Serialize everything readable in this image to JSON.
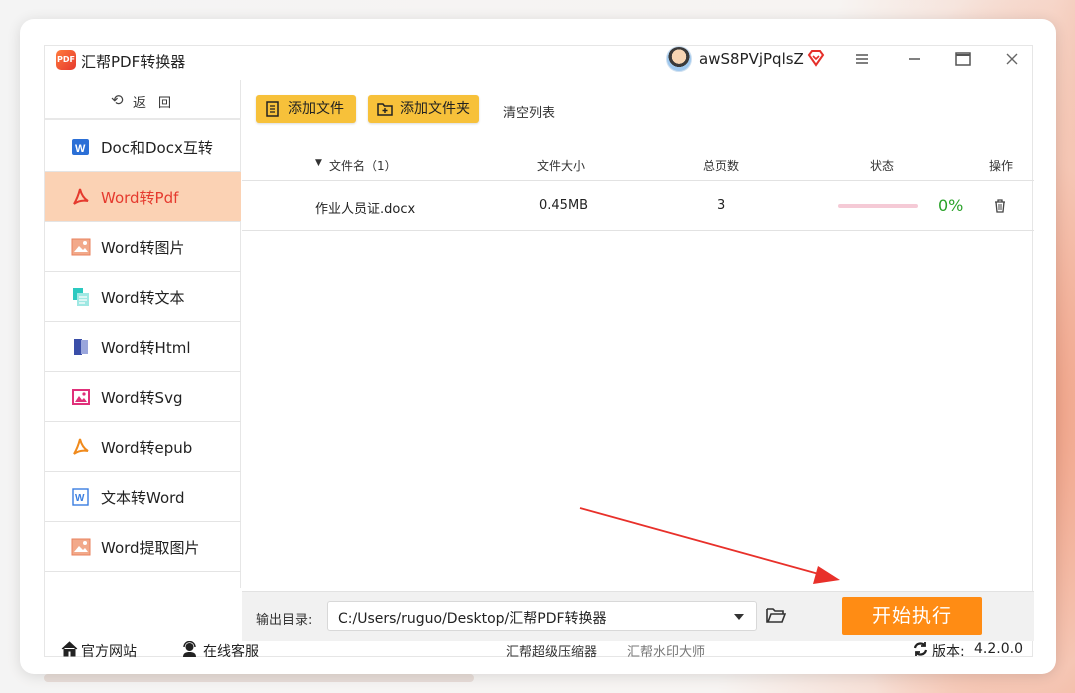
{
  "app": {
    "title": "汇帮PDF转换器",
    "logo_text": "PDF",
    "username": "awS8PVjPqlsZ"
  },
  "sidebar": {
    "back_label": "返回",
    "items": [
      {
        "label": "Doc和Docx互转",
        "icon": "word-icon",
        "color": "#2b6fd6"
      },
      {
        "label": "Word转Pdf",
        "icon": "pdf-icon",
        "color": "#e53a2e",
        "active": true
      },
      {
        "label": "Word转图片",
        "icon": "image-icon",
        "color": "#e8825e"
      },
      {
        "label": "Word转文本",
        "icon": "text-doc-icon",
        "color": "#2bc9c0"
      },
      {
        "label": "Word转Html",
        "icon": "book-icon",
        "color": "#3a4ea8"
      },
      {
        "label": "Word转Svg",
        "icon": "image-icon",
        "color": "#e0307a"
      },
      {
        "label": "Word转epub",
        "icon": "pdf-icon",
        "color": "#f08a1c"
      },
      {
        "label": "文本转Word",
        "icon": "word-icon",
        "color": "#3a7ee0"
      },
      {
        "label": "Word提取图片",
        "icon": "image-icon",
        "color": "#e8825e"
      }
    ]
  },
  "toolbar": {
    "add_file": "添加文件",
    "add_folder": "添加文件夹",
    "clear_list": "清空列表"
  },
  "table": {
    "headers": {
      "filename": "文件名（1）",
      "size": "文件大小",
      "pages": "总页数",
      "status": "状态",
      "action": "操作"
    },
    "rows": [
      {
        "filename": "作业人员证.docx",
        "size": "0.45MB",
        "pages": "3",
        "progress": 0,
        "progress_text": "0%"
      }
    ]
  },
  "output": {
    "label": "输出目录:",
    "path": "C:/Users/ruguo/Desktop/汇帮PDF转换器",
    "start": "开始执行"
  },
  "footer": {
    "website": "官方网站",
    "service": "在线客服",
    "compressor": "汇帮超级压缩器",
    "watermark": "汇帮水印大师",
    "version_label": "版本:",
    "version": "4.2.0.0"
  },
  "colors": {
    "accent": "#ff8c14",
    "button": "#f7c13a",
    "active_bg": "#fbd2b4",
    "active_text": "#e53a2e"
  }
}
